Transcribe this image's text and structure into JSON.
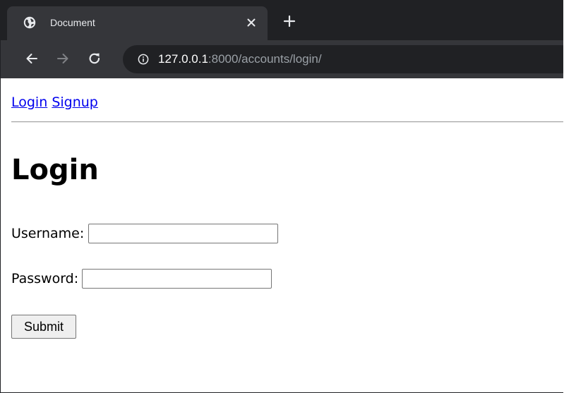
{
  "browser": {
    "tab": {
      "title": "Document",
      "icon": "globe-icon",
      "close_icon": "close-icon"
    },
    "new_tab_icon": "plus-icon",
    "toolbar": {
      "back_icon": "arrow-left-icon",
      "forward_icon": "arrow-right-icon",
      "reload_icon": "reload-icon",
      "info_icon": "info-icon"
    },
    "url": {
      "host": "127.0.0.1",
      "rest": ":8000/accounts/login/"
    },
    "colors": {
      "tabstrip": "#202124",
      "toolbar": "#35363a",
      "link": "#0000ee"
    }
  },
  "page": {
    "nav": {
      "login_link": "Login",
      "signup_link": "Signup"
    },
    "title": "Login",
    "form": {
      "username_label": "Username:",
      "username_value": "",
      "password_label": "Password:",
      "password_value": "",
      "submit_label": "Submit"
    }
  }
}
